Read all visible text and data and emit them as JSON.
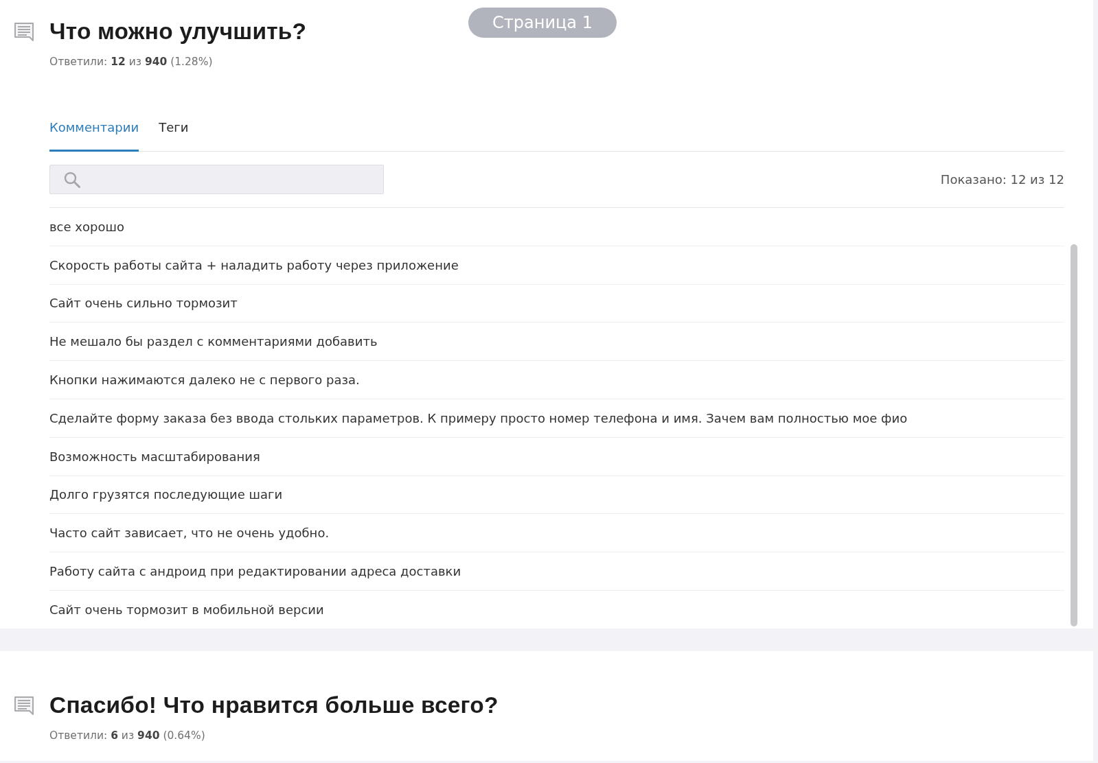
{
  "page_badge": "Страница 1",
  "questions": [
    {
      "title": "Что можно улучшить?",
      "responses": "Ответили: **12** из **940** (1.28%)",
      "tabs": [
        {
          "label": "Комментарии",
          "selected": true
        },
        {
          "label": "Теги",
          "selected": false
        }
      ],
      "search_field": true,
      "shown": "Показано: 12 из 12",
      "comments": [
        "все хорошо",
        "Скорость работы сайта + наладить работу через приложение",
        "Сайт очень сильно тормозит",
        "Не мешало бы раздел с комментариями добавить",
        "Кнопки нажимаются далеко не с первого раза.",
        "Сделайте форму заказа без ввода стольких параметров. К примеру просто номер телефона и имя. Зачем вам полностью мое фио",
        "Возможность масштабирования",
        "Долго грузятся последующие шаги",
        "Часто сайт зависает, что не очень удобно.",
        "Работу сайта с андроид при редактировании адреса доставки",
        "Сайт очень тормозит в мобильной версии"
      ]
    },
    {
      "title": "Спасибо! Что нравится больше всего?",
      "responses": "Ответили: **6** из **940** (0.64%)"
    }
  ]
}
